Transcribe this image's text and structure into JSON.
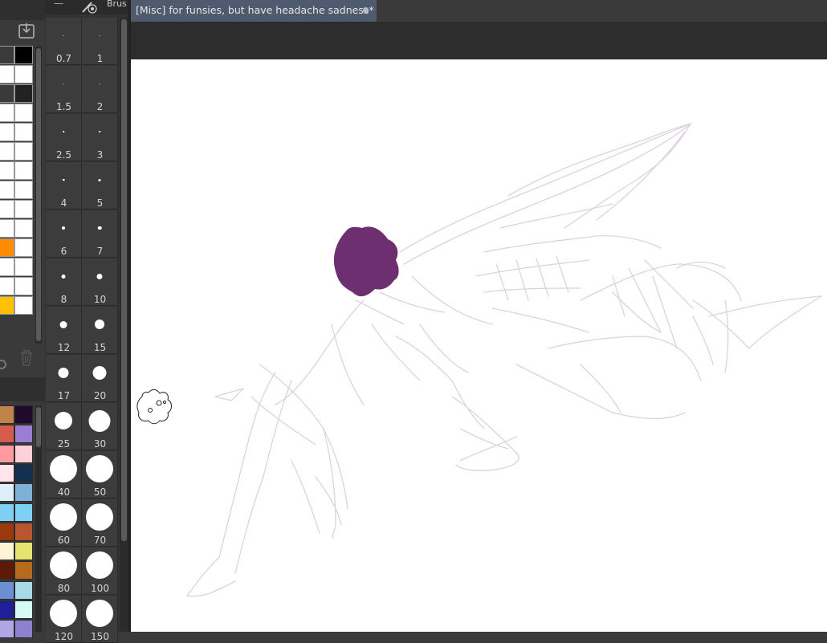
{
  "window": {
    "brush_tab_label": "Brus",
    "document_title": "[Misc] for funsies, but have headache sadness*"
  },
  "tone_grid": [
    [
      "#3a3a3a",
      "#000000"
    ],
    [
      "#ffffff",
      "#ffffff"
    ],
    [
      "#3a3a3a",
      "#222222"
    ],
    [
      "#ffffff",
      "#ffffff"
    ],
    [
      "#ffffff",
      "#ffffff"
    ],
    [
      "#ffffff",
      "#ffffff"
    ],
    [
      "#ffffff",
      "#ffffff"
    ],
    [
      "#ffffff",
      "#ffffff"
    ],
    [
      "#ffffff",
      "#ffffff"
    ],
    [
      "#ffffff",
      "#ffffff"
    ],
    [
      "#ff8c00",
      "#ffffff"
    ],
    [
      "#ffffff",
      "#ffffff"
    ],
    [
      "#ffffff",
      "#ffffff"
    ],
    [
      "#ffc000",
      "#ffffff"
    ]
  ],
  "palette": [
    [
      "#c0844a",
      "#1e0a2a"
    ],
    [
      "#d65b4a",
      "#9a7ed6"
    ],
    [
      "#ff9aa0",
      "#ffd0d8"
    ],
    [
      "#ffe4ea",
      "#13314f"
    ],
    [
      "#dfeffa",
      "#7fb1d8"
    ],
    [
      "#7fcff5",
      "#7fd0f5"
    ],
    [
      "#9a3a0c",
      "#b8572f"
    ],
    [
      "#fff5d6",
      "#e4e46e"
    ],
    [
      "#5e1a06",
      "#b56a1e"
    ],
    [
      "#6b8fd0",
      "#a8dae6"
    ],
    [
      "#1f1f9a",
      "#d6fbf6"
    ],
    [
      "#b0a6e6",
      "#8f7fcf"
    ]
  ],
  "brush_sizes": [
    {
      "label": "0.7",
      "dot": 1
    },
    {
      "label": "1",
      "dot": 1
    },
    {
      "label": "1.5",
      "dot": 1
    },
    {
      "label": "2",
      "dot": 1
    },
    {
      "label": "2.5",
      "dot": 1.5
    },
    {
      "label": "3",
      "dot": 1.5
    },
    {
      "label": "4",
      "dot": 2.5
    },
    {
      "label": "5",
      "dot": 3
    },
    {
      "label": "6",
      "dot": 4
    },
    {
      "label": "7",
      "dot": 4.5
    },
    {
      "label": "8",
      "dot": 5
    },
    {
      "label": "10",
      "dot": 7
    },
    {
      "label": "12",
      "dot": 9
    },
    {
      "label": "15",
      "dot": 12
    },
    {
      "label": "17",
      "dot": 13
    },
    {
      "label": "20",
      "dot": 17
    },
    {
      "label": "25",
      "dot": 22
    },
    {
      "label": "30",
      "dot": 27
    },
    {
      "label": "40",
      "dot": 34
    },
    {
      "label": "50",
      "dot": 34
    },
    {
      "label": "60",
      "dot": 34
    },
    {
      "label": "70",
      "dot": 34
    },
    {
      "label": "80",
      "dot": 34
    },
    {
      "label": "100",
      "dot": 34
    },
    {
      "label": "120",
      "dot": 34
    },
    {
      "label": "150",
      "dot": 34
    }
  ],
  "colors": {
    "hair_paint": "#6e2f71",
    "sketch_line": "#ddd2de",
    "tab_active": "#505a6e"
  }
}
